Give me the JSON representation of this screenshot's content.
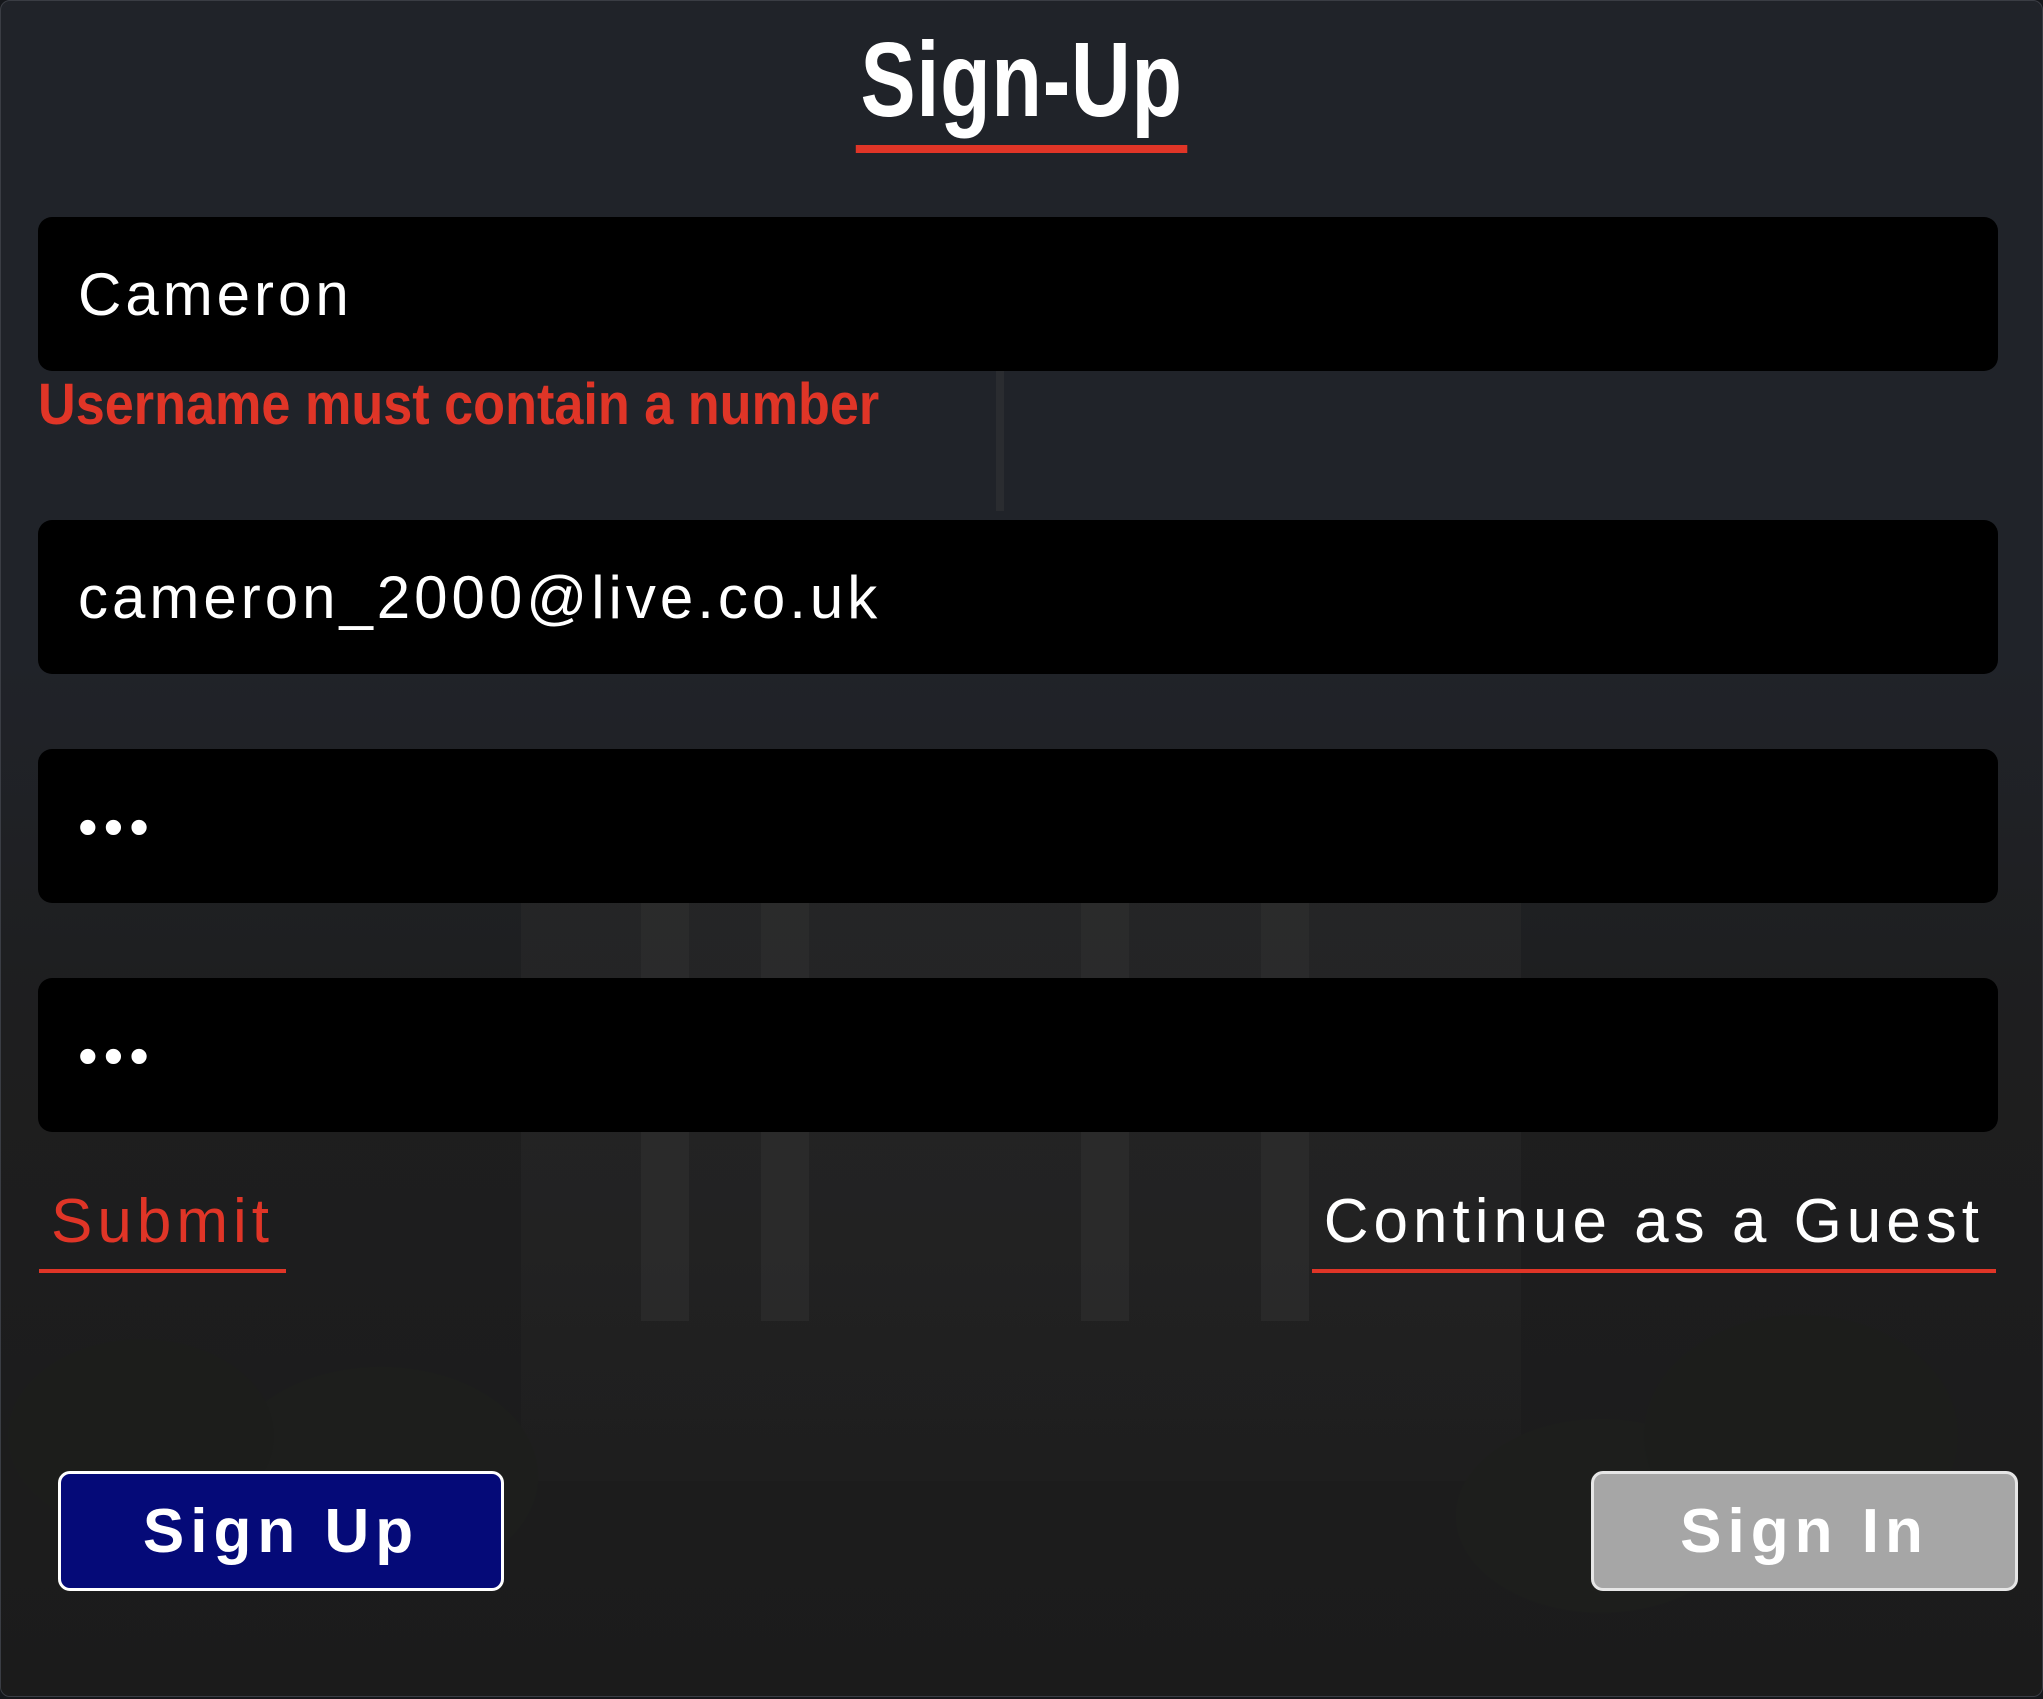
{
  "title": "Sign-Up",
  "form": {
    "username_value": "Cameron",
    "username_error": "Username must contain a number",
    "email_value": "cameron_2000@live.co.uk",
    "password_value": "•••",
    "confirm_value": "•••"
  },
  "links": {
    "submit": "Submit",
    "guest": "Continue as a Guest"
  },
  "buttons": {
    "sign_up": "Sign Up",
    "sign_in": "Sign In"
  },
  "colors": {
    "accent": "#e03527",
    "sign_up_bg": "#050a78",
    "sign_in_bg": "#a6a6a6",
    "field_bg": "#000000"
  }
}
